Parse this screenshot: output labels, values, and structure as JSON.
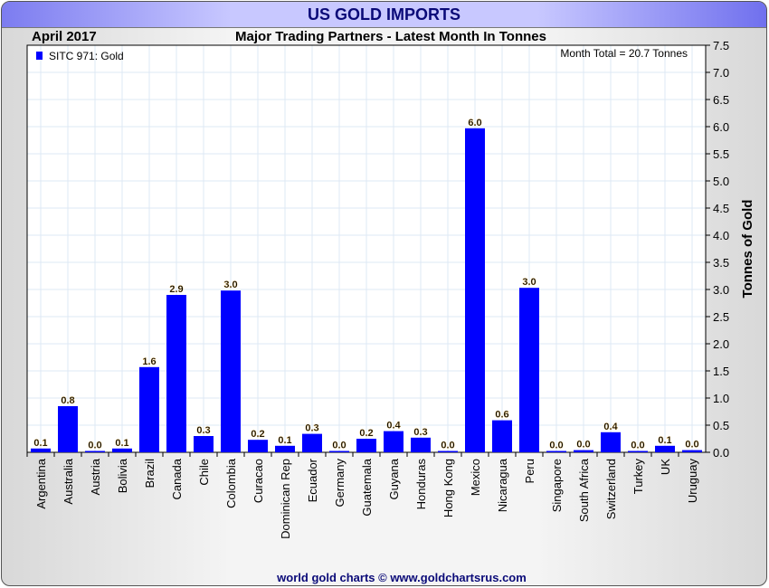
{
  "window_title": "US GOLD IMPORTS",
  "footer": "world gold charts © www.goldchartsrus.com",
  "chart_data": {
    "type": "bar",
    "title": "Major Trading Partners - Latest Month In Tonnes",
    "period": "April 2017",
    "annotation": "Month Total = 20.7 Tonnes",
    "legend": [
      {
        "name": "SITC 971: Gold",
        "color": "#0000ff"
      }
    ],
    "legend_placement": "top-left",
    "ylabel": "Tonnes of Gold",
    "xlabel": "",
    "ylim": [
      0,
      7.5
    ],
    "yticks": [
      "0.0",
      "0.5",
      "1.0",
      "1.5",
      "2.0",
      "2.5",
      "3.0",
      "3.5",
      "4.0",
      "4.5",
      "5.0",
      "5.5",
      "6.0",
      "6.5",
      "7.0",
      "7.5"
    ],
    "grid": true,
    "categories": [
      "Argentina",
      "Australia",
      "Austria",
      "Bolivia",
      "Brazil",
      "Canada",
      "Chile",
      "Colombia",
      "Curacao",
      "Dominican Rep",
      "Ecuador",
      "Germany",
      "Guatemala",
      "Guyana",
      "Honduras",
      "Hong Kong",
      "Mexico",
      "Nicaragua",
      "Peru",
      "Singapore",
      "South Africa",
      "Switzerland",
      "Turkey",
      "UK",
      "Uruguay"
    ],
    "values": [
      0.07,
      0.85,
      0.0,
      0.07,
      1.57,
      2.9,
      0.3,
      2.98,
      0.23,
      0.12,
      0.34,
      0.02,
      0.25,
      0.39,
      0.27,
      0.01,
      5.97,
      0.59,
      3.03,
      0.01,
      0.04,
      0.37,
      0.01,
      0.12,
      0.04
    ],
    "labels": [
      "0.1",
      "0.8",
      "0.0",
      "0.1",
      "1.6",
      "2.9",
      "0.3",
      "3.0",
      "0.2",
      "0.1",
      "0.3",
      "0.0",
      "0.2",
      "0.4",
      "0.3",
      "0.0",
      "6.0",
      "0.6",
      "3.0",
      "0.0",
      "0.0",
      "0.4",
      "0.0",
      "0.1",
      "0.0"
    ],
    "bar_color": "#0000ff"
  }
}
